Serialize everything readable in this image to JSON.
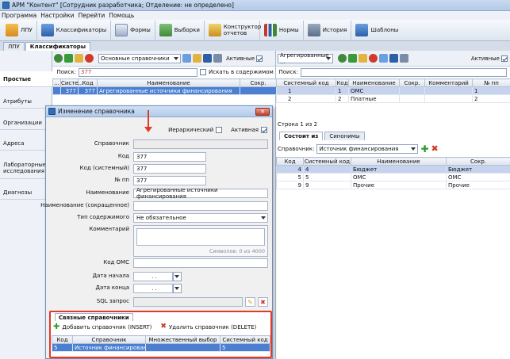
{
  "window": {
    "title": "АРМ \"Контент\" [Сотрудник разработчика; Отделение: не определено]"
  },
  "menu": [
    "Программа",
    "Настройки",
    "Перейти",
    "Помощь"
  ],
  "toolbar": [
    {
      "label": "ЛПУ",
      "icon": "hospital-icon"
    },
    {
      "label": "Классификаторы",
      "icon": "classifiers-icon"
    },
    {
      "label": "Формы",
      "icon": "forms-icon"
    },
    {
      "label": "Выборки",
      "icon": "selections-icon"
    },
    {
      "label": "Конструктор отчетов",
      "icon": "report-builder-icon"
    },
    {
      "label": "Нормы",
      "icon": "norms-icon"
    },
    {
      "label": "История",
      "icon": "history-icon"
    },
    {
      "label": "Шаблоны",
      "icon": "templates-icon"
    }
  ],
  "tabs": [
    "ЛПУ",
    "Классификаторы"
  ],
  "left_tabs": [
    "Простые",
    "Атрибуты",
    "Организации",
    "Адреса",
    "Лабораторные исследования",
    "Диагнозы"
  ],
  "left_grid": {
    "dropdown": "Основные справочники",
    "active_label": "Активные",
    "search_label": "Поиск:",
    "search_value": "377",
    "search_content_label": "Искать в содержимом",
    "columns": [
      "...",
      "Систе...",
      "Код",
      "Наименование",
      "Сокр."
    ],
    "rows": [
      [
        "",
        "377",
        "377",
        "Агрегированные источники финансирования",
        ""
      ]
    ]
  },
  "right_grid": {
    "dropdown": "Агрегированные ...",
    "active_label": "Активные",
    "search_label": "Поиск:",
    "columns": [
      "Системный код",
      "Код",
      "Наименование",
      "Сокр.",
      "Комментарий",
      "№ пп"
    ],
    "rows": [
      [
        "1",
        "1",
        "ОМС",
        "",
        "",
        "1"
      ],
      [
        "2",
        "2",
        "Платные",
        "",
        "",
        "2"
      ]
    ],
    "row_count": "Строка 1 из 2"
  },
  "composition": {
    "tabs": [
      "Состоит из",
      "Синонимы"
    ],
    "ref_label": "Справочник:",
    "ref_value": "Источник финансирования",
    "columns": [
      "Код",
      "Системный код",
      "Наименование",
      "Сокр."
    ],
    "rows": [
      [
        "4",
        "4",
        "Бюджет",
        "Бюджет"
      ],
      [
        "5",
        "5",
        "ОМС",
        "ОМС"
      ],
      [
        "9",
        "9",
        "Прочие",
        "Прочие"
      ]
    ]
  },
  "dialog": {
    "title": "Изменение справочника",
    "hierarchical_label": "Иерархический",
    "active_label": "Активная",
    "fields": {
      "ref_label": "Справочник",
      "code_label": "Код",
      "code_value": "377",
      "syscode_label": "Код (системный)",
      "syscode_value": "377",
      "num_label": "№ пп",
      "num_value": "377",
      "name_label": "Наименование",
      "name_value": "Агрегированные источники финансирования",
      "short_label": "Наименование (сокращенное)",
      "content_type_label": "Тип содержимого",
      "content_type_value": "Не обязательное",
      "comment_label": "Комментарий",
      "symbols": "Символов: 0 из 4000",
      "oms_label": "Код ОМС",
      "start_label": "Дата начала",
      "end_label": "Дата конца",
      "date_placeholder": ". .",
      "sql_label": "SQL запрос"
    },
    "related": {
      "tab": "Связные справочники",
      "add_label": "Добавить справочник (INSERT)",
      "delete_label": "Удалить справочник (DELETE)",
      "columns": [
        "Код",
        "Справочник",
        "Множественный выбор",
        "Системный код"
      ],
      "rows": [
        [
          "5",
          "Источник финансирования",
          "",
          "5"
        ]
      ]
    }
  },
  "colors": {
    "accent": "#4a7fd1",
    "highlight": "#e03a2a"
  }
}
